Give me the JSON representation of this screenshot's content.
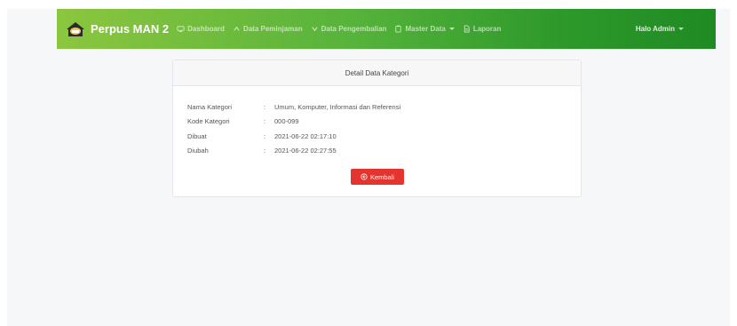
{
  "navbar": {
    "brand": "Perpus MAN 2",
    "items": [
      {
        "label": "Dashboard",
        "icon": "monitor-icon"
      },
      {
        "label": "Data Peminjaman",
        "icon": "chevron-up-icon"
      },
      {
        "label": "Data Pengembalian",
        "icon": "chevron-down-icon"
      },
      {
        "label": "Master Data",
        "icon": "clipboard-icon",
        "dropdown": true
      },
      {
        "label": "Laporan",
        "icon": "file-icon"
      }
    ],
    "user_menu": "Halo Admin"
  },
  "card": {
    "title": "Detail Data Kategori",
    "rows": [
      {
        "label": "Nama Kategori",
        "value": "Umum, Komputer, Informasi dan Referensi"
      },
      {
        "label": "Kode Kategori",
        "value": "000-099"
      },
      {
        "label": "Dibuat",
        "value": "2021-06-22 02:17:10"
      },
      {
        "label": "Diubah",
        "value": "2021-06-22 02:27:55"
      }
    ],
    "colon": ":",
    "back_button": "Kembali"
  },
  "colors": {
    "navbar_start": "#8cc63f",
    "navbar_end": "#1f8a23",
    "button_danger": "#e3342f"
  }
}
